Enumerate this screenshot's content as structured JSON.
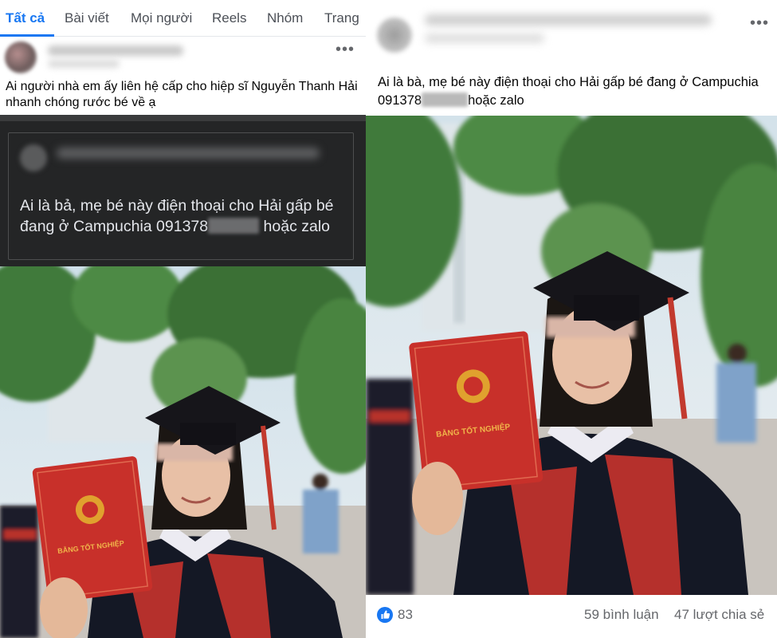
{
  "tabs": [
    {
      "label": "Tất cả",
      "active": true
    },
    {
      "label": "Bài viết",
      "active": false
    },
    {
      "label": "Mọi người",
      "active": false
    },
    {
      "label": "Reels",
      "active": false
    },
    {
      "label": "Nhóm",
      "active": false
    },
    {
      "label": "Trang",
      "active": false
    }
  ],
  "left_post": {
    "more_glyph": "•••",
    "caption": "Ai người nhà em ấy liên hệ cấp cho hiệp sĩ Nguyễn Thanh Hải nhanh chóng rước bé về ạ",
    "shared_text_before": "Ai là bả, mẹ bé này điện thoại cho Hải gấp bé đang ở Campuchia 091378",
    "shared_text_after": " hoặc zalo"
  },
  "right_post": {
    "more_glyph": "•••",
    "caption_before": "Ai là bà, mẹ bé này điện thoại cho Hải gấp bé đang ở Campuchia 091378",
    "caption_after": "hoặc zalo",
    "likes": "83",
    "comments": "59 bình luận",
    "shares": "47 lượt chia sẻ"
  },
  "diploma_text": "BẰNG TỐT NGHIỆP",
  "colors": {
    "accent": "#1877f2",
    "diploma_red": "#c8302a",
    "gown_black": "#141825",
    "tree_green": "#3f7a3a",
    "dark_bg": "#242526"
  }
}
